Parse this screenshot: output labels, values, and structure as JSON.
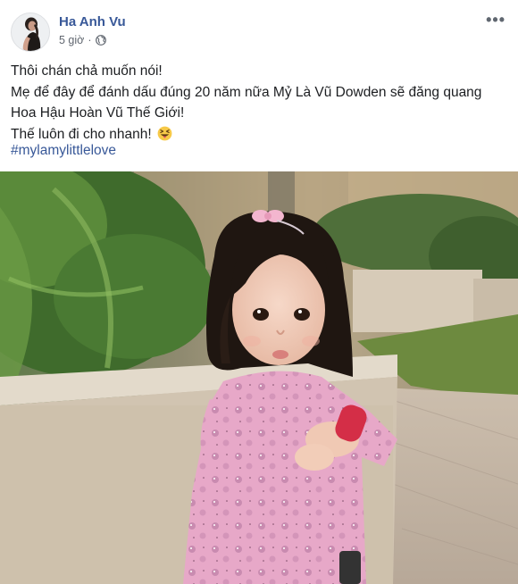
{
  "post": {
    "author": "Ha Anh Vu",
    "time": "5 giờ",
    "separator": "·",
    "privacy_icon": "globe-icon",
    "more_label": "•••",
    "text_lines": [
      "Thôi chán chả muốn nói!",
      "Mẹ để đây để đánh dấu đúng 20 năm nữa Mỷ Là Vũ Dowden sẽ đăng quang",
      "Hoa Hậu Hoàn Vũ Thế Giới!",
      "Thế luôn đi cho nhanh!"
    ],
    "emoji": "squinting-tongue-emoji",
    "hashtag": "#mylamylittlelove",
    "photo_subject": "toddler-photo"
  },
  "colors": {
    "link": "#385898",
    "text": "#1c1e21",
    "meta": "#616770"
  }
}
